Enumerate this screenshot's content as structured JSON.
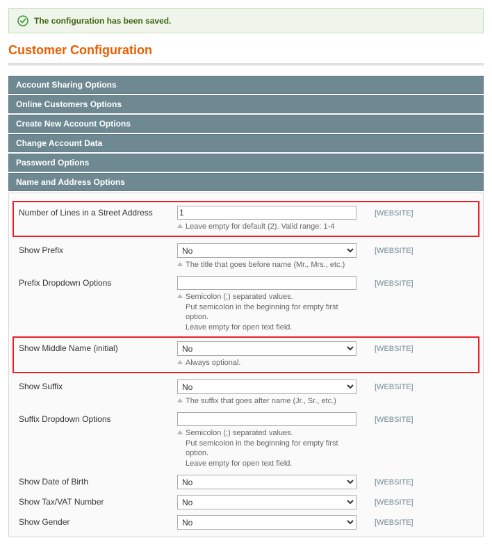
{
  "success_message": "The configuration has been saved.",
  "page_title": "Customer Configuration",
  "scope_label": "[WEBSITE]",
  "sections": {
    "account_sharing": "Account Sharing Options",
    "online_customers": "Online Customers Options",
    "create_account": "Create New Account Options",
    "change_account": "Change Account Data",
    "password": "Password Options",
    "name_address": "Name and Address Options"
  },
  "fields": {
    "street_lines": {
      "label": "Number of Lines in a Street Address",
      "value": "1",
      "note": "Leave empty for default (2). Valid range: 1-4"
    },
    "show_prefix": {
      "label": "Show Prefix",
      "value": "No",
      "note": "The title that goes before name (Mr., Mrs., etc.)"
    },
    "prefix_options": {
      "label": "Prefix Dropdown Options",
      "value": "",
      "note": "Semicolon (;) separated values.\nPut semicolon in the beginning for empty first option.\nLeave empty for open text field."
    },
    "show_middle": {
      "label": "Show Middle Name (initial)",
      "value": "No",
      "note": "Always optional."
    },
    "show_suffix": {
      "label": "Show Suffix",
      "value": "No",
      "note": "The suffix that goes after name (Jr., Sr., etc.)"
    },
    "suffix_options": {
      "label": "Suffix Dropdown Options",
      "value": "",
      "note": "Semicolon (;) separated values.\nPut semicolon in the beginning for empty first option.\nLeave empty for open text field."
    },
    "show_dob": {
      "label": "Show Date of Birth",
      "value": "No"
    },
    "show_tax": {
      "label": "Show Tax/VAT Number",
      "value": "No"
    },
    "show_gender": {
      "label": "Show Gender",
      "value": "No"
    }
  }
}
